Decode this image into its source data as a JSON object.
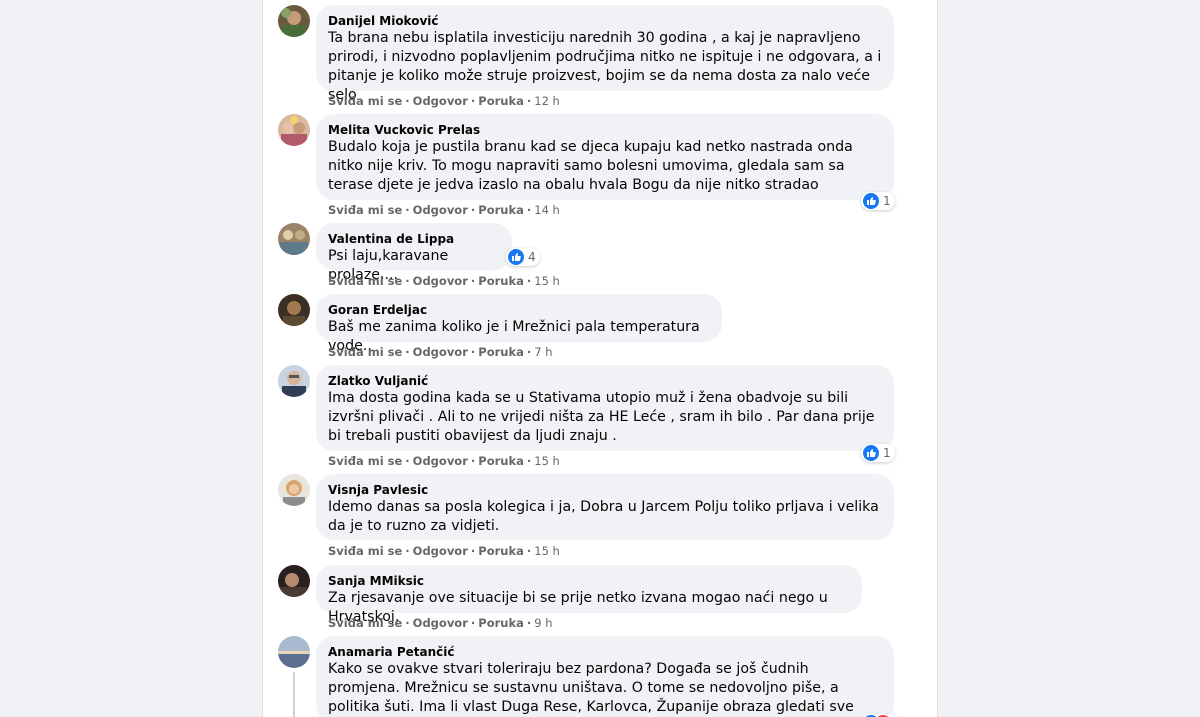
{
  "actions": {
    "like": "Sviđa mi se",
    "reply": "Odgovor",
    "message": "Poruka",
    "separator": "·"
  },
  "comments": [
    {
      "author": "Danijel Mioković",
      "text": "Ta brana nebu isplatila investiciju narednih 30 godina , a kaj je napravljeno prirodi, i nizvodno poplavljenim područjima nitko ne ispituje i ne odgovara, a i pitanje je koliko može struje proizvest, bojim se da nema dosta za nalo veće selo",
      "time": "12 h"
    },
    {
      "author": "Melita Vuckovic Prelas",
      "text": "Budalo koja je pustila branu kad se djeca kupaju kad netko nastrada onda nitko nije kriv. To mogu napraviti samo bolesni umovima, gledala sam sa terase djete je jedva izaslo na obalu hvala Bogu da nije nitko stradao",
      "time": "14 h",
      "likes": "1"
    },
    {
      "author": "Valentina de Lippa",
      "text": "Psi laju,karavane prolaze....",
      "time": "15 h",
      "likes": "4"
    },
    {
      "author": "Goran Erdeljac",
      "text": "Baš me zanima koliko je i Mrežnici pala temperatura vode..",
      "time": "7 h"
    },
    {
      "author": "Zlatko Vuljanić",
      "text": "Ima dosta godina kada se u Stativama utopio muž i žena obadvoje su bili izvršni plivači . Ali to ne vrijedi ništa za HE Leće , sram ih bilo . Par dana prije bi trebali pustiti obavijest da ljudi znaju .",
      "time": "15 h",
      "likes": "1"
    },
    {
      "author": "Visnja Pavlesic",
      "text": "Idemo danas sa posla kolegica i ja, Dobra u Jarcem Polju toliko prljava i velika da je to ruzno za vidjeti.",
      "time": "15 h"
    },
    {
      "author": "Sanja MMiksic",
      "text": "Za rjesavanje ove situacije bi se prije netko izvana mogao naći nego u Hrvatskoj.",
      "time": "9 h"
    },
    {
      "author": "Anamaria Petančić",
      "text": "Kako se ovakve stvari toleriraju bez pardona? Događa se još čudnih promjena. Mrežnicu se sustavnu uništava. O tome se nedovoljno piše, a politika šuti. Ima li vlast Duga Rese, Karlovca, Županije obraza gledati sve to?!"
    }
  ],
  "colors": {
    "accent": "#1877f2",
    "bubble": "#f0f2f5",
    "meta": "#65676b"
  }
}
